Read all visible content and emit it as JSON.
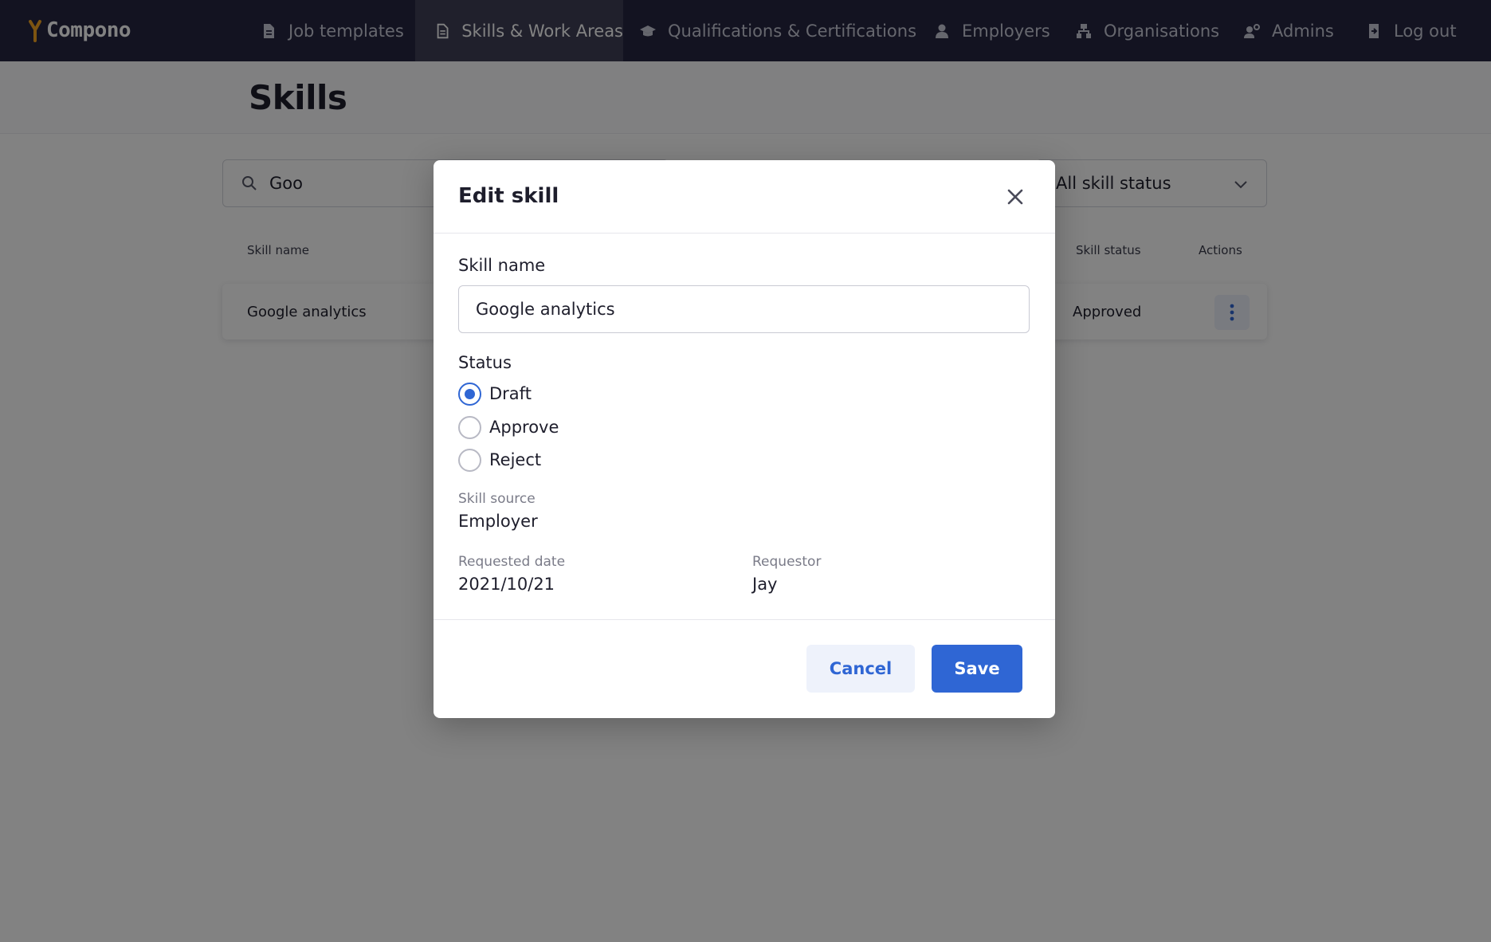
{
  "app": {
    "brand": "Compono",
    "colors": {
      "nav_bg": "#262741",
      "accent": "#2f66d4",
      "brand_mark": "#f5a623"
    }
  },
  "nav": {
    "items": [
      {
        "label": "Job templates",
        "icon": "document-icon",
        "active": false
      },
      {
        "label": "Skills & Work Areas",
        "icon": "document-list-icon",
        "active": true
      },
      {
        "label": "Qualifications & Certifications",
        "icon": "graduation-cap-icon",
        "active": false
      },
      {
        "label": "Employers",
        "icon": "person-icon",
        "active": false
      },
      {
        "label": "Organisations",
        "icon": "org-chart-icon",
        "active": false
      },
      {
        "label": "Admins",
        "icon": "admin-gear-icon",
        "active": false
      },
      {
        "label": "Log out",
        "icon": "logout-icon",
        "active": false
      }
    ]
  },
  "page": {
    "title": "Skills",
    "search": {
      "value": "Goo"
    },
    "status_filter": {
      "value": "All skill status"
    },
    "table": {
      "headers": {
        "skill_name": "Skill name",
        "skill_status": "Skill status",
        "actions": "Actions"
      },
      "rows": [
        {
          "skill_name": "Google analytics",
          "skill_status": "Approved"
        }
      ]
    }
  },
  "modal": {
    "title": "Edit skill",
    "skill_name_label": "Skill name",
    "skill_name_value": "Google analytics",
    "status_label": "Status",
    "status_options": [
      {
        "label": "Draft",
        "checked": true
      },
      {
        "label": "Approve",
        "checked": false
      },
      {
        "label": "Reject",
        "checked": false
      }
    ],
    "skill_source_label": "Skill source",
    "skill_source_value": "Employer",
    "requested_date_label": "Requested date",
    "requested_date_value": "2021/10/21",
    "requestor_label": "Requestor",
    "requestor_value": "Jay",
    "cancel_label": "Cancel",
    "save_label": "Save"
  }
}
